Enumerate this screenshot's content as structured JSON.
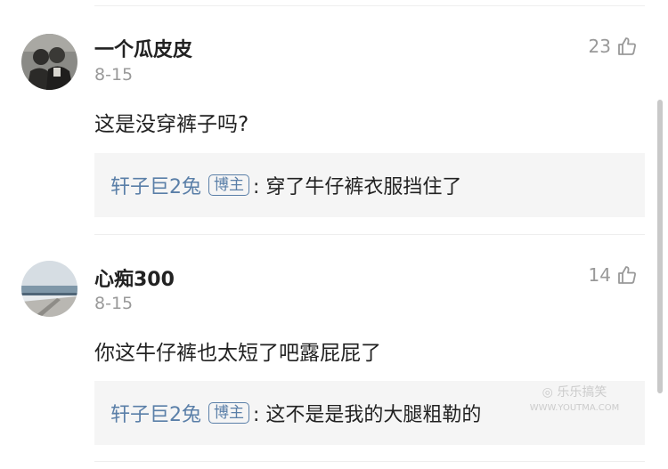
{
  "comments": [
    {
      "username": "一个瓜皮皮",
      "date": "8-15",
      "likes": "23",
      "text": "这是没穿裤子吗?",
      "reply": {
        "name": "轩子巨2兔",
        "badge": "博主",
        "text": ": 穿了牛仔裤衣服挡住了"
      }
    },
    {
      "username": "心痴300",
      "date": "8-15",
      "likes": "14",
      "text": "你这牛仔裤也太短了吧露屁屁了",
      "reply": {
        "name": "轩子巨2兔",
        "badge": "博主",
        "text": ": 这不是是我的大腿粗勒的"
      }
    }
  ],
  "watermark": {
    "line1": "◎ 乐乐搞笑",
    "line2": "WWW.YOUTMA.COM"
  },
  "colors": {
    "reply_name": "#5a7fa8",
    "reply_bg": "#f5f5f5",
    "muted": "#999999"
  },
  "icons": {
    "like": "thumb-up-icon"
  }
}
